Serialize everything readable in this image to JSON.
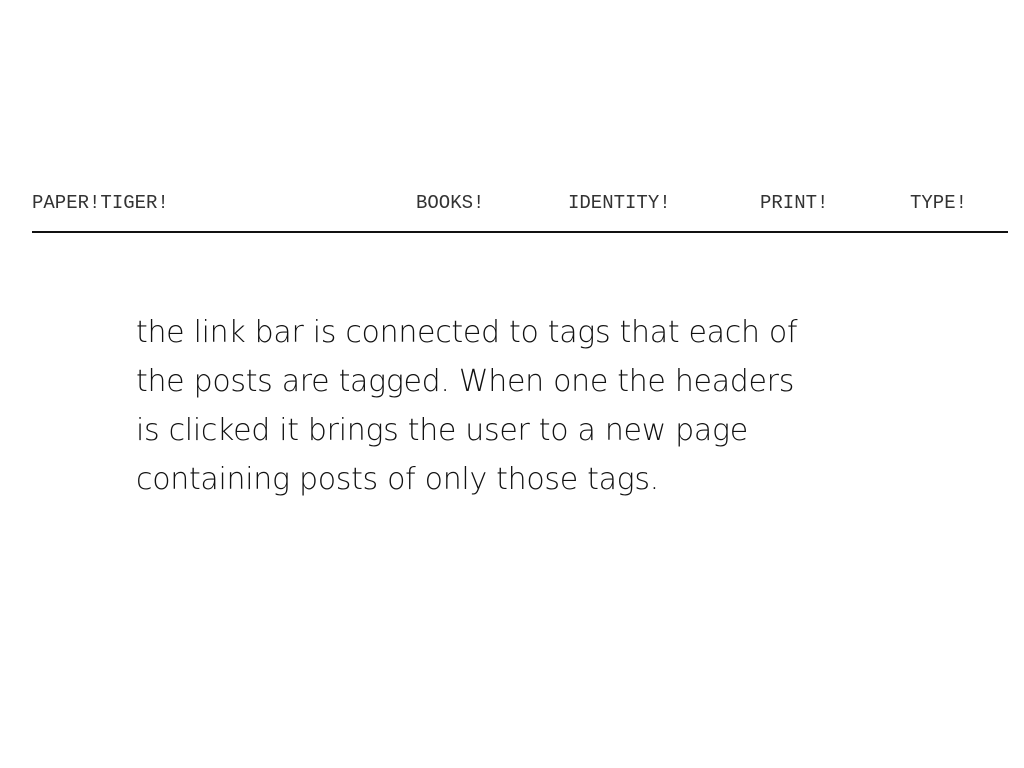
{
  "header": {
    "brand": "PAPER!TIGER!",
    "nav": [
      {
        "label": "BOOKS!"
      },
      {
        "label": "IDENTITY!"
      },
      {
        "label": "PRINT!"
      },
      {
        "label": "TYPE!"
      }
    ]
  },
  "main": {
    "caption_lines": [
      "the link bar is connected to tags that each of",
      "the posts are tagged. When one the headers",
      "is clicked it brings the user to a new page",
      "containing posts of only those tags."
    ]
  }
}
